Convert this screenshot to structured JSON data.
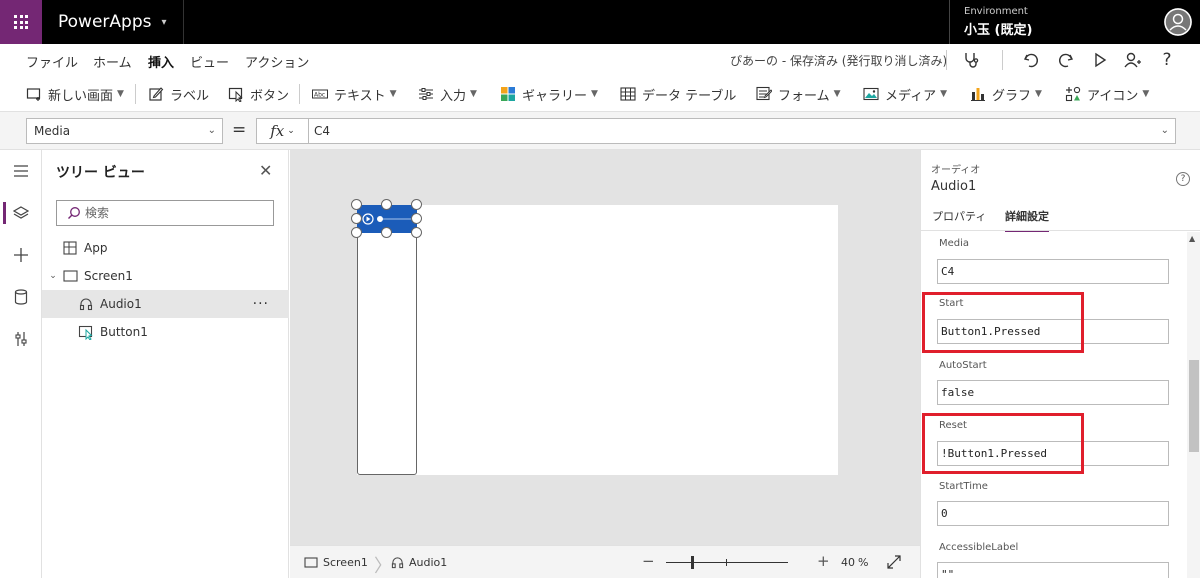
{
  "header": {
    "app_name": "PowerApps",
    "environment_label": "Environment",
    "environment_name": "小玉 (既定)"
  },
  "menu": {
    "items": [
      "ファイル",
      "ホーム",
      "挿入",
      "ビュー",
      "アクション"
    ],
    "active": "挿入",
    "status": "ぴあーの - 保存済み (発行取り消し済み)"
  },
  "ribbon": {
    "new_screen": "新しい画面",
    "label": "ラベル",
    "button": "ボタン",
    "text": "テキスト",
    "input": "入力",
    "gallery": "ギャラリー",
    "data_table": "データ テーブル",
    "form": "フォーム",
    "media": "メディア",
    "chart": "グラフ",
    "icons": "アイコン"
  },
  "formula": {
    "property": "Media",
    "fx": "fx",
    "value": "C4"
  },
  "tree": {
    "title": "ツリー ビュー",
    "search_placeholder": "検索",
    "items": [
      {
        "label": "App"
      },
      {
        "label": "Screen1"
      },
      {
        "label": "Audio1"
      },
      {
        "label": "Button1"
      }
    ],
    "more": "···"
  },
  "canvas_status": {
    "crumbs": [
      "Screen1",
      "Audio1"
    ],
    "zoom_value": "40",
    "zoom_unit": "%"
  },
  "props": {
    "control_type": "オーディオ",
    "control_name": "Audio1",
    "tabs": [
      "プロパティ",
      "詳細設定"
    ],
    "active_tab": "詳細設定",
    "fields": [
      {
        "label": "Media",
        "value": "C4"
      },
      {
        "label": "Start",
        "value": "Button1.Pressed"
      },
      {
        "label": "AutoStart",
        "value": "false"
      },
      {
        "label": "Reset",
        "value": "!Button1.Pressed"
      },
      {
        "label": "StartTime",
        "value": "0"
      },
      {
        "label": "AccessibleLabel",
        "value": "\"\""
      }
    ]
  },
  "colors": {
    "brand": "#742774",
    "highlight": "#e01f2c",
    "audio_control": "#1b5cb9"
  }
}
